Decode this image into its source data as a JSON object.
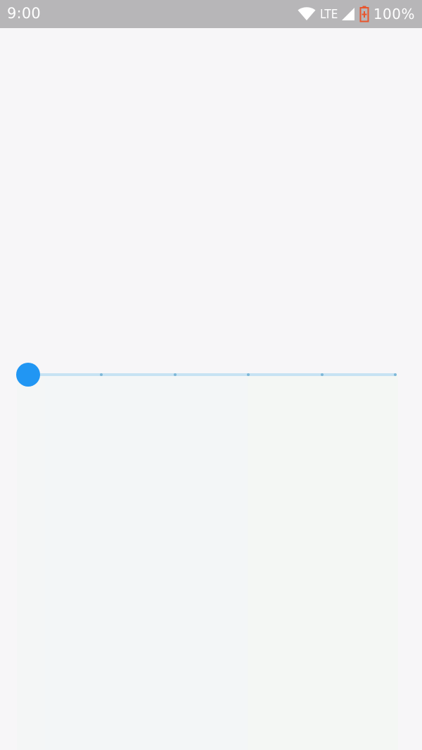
{
  "status_bar": {
    "time": "9:00",
    "network": "LTE",
    "battery": "100%",
    "icons": [
      "wifi-icon",
      "cellular-signal-icon",
      "battery-charging-icon"
    ]
  },
  "slider": {
    "value_fraction": 0.0,
    "tick_count": 6,
    "accent_color": "#2196f3",
    "track_color": "#c7e3f3"
  }
}
